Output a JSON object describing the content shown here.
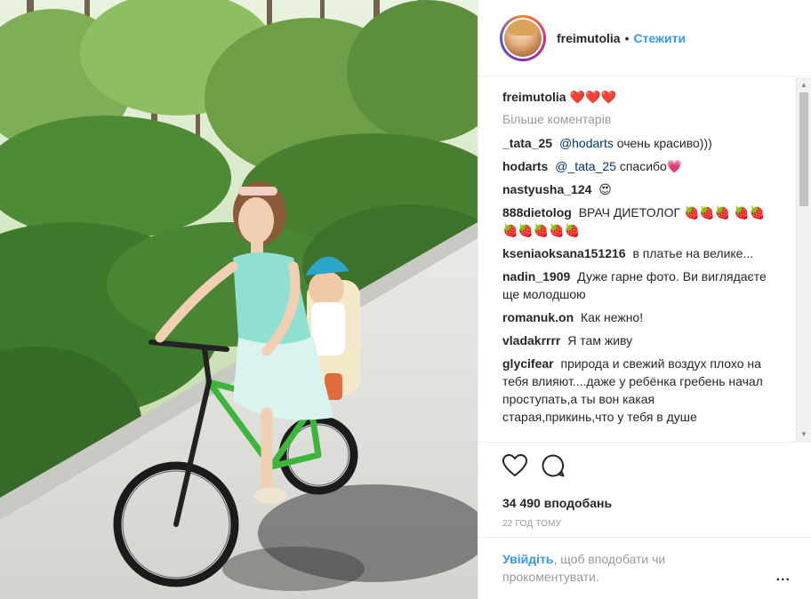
{
  "post": {
    "username": "freimutolia",
    "follow_label": "Стежити",
    "dot": "•"
  },
  "photo": {
    "alt_subject": "woman-on-bicycle-with-child"
  },
  "comments": {
    "caption": {
      "user": "freimutolia",
      "text": "❤️❤️❤️"
    },
    "load_more": "Більше коментарів",
    "items": [
      {
        "user": "_tata_25",
        "mention": "@hodarts",
        "text": "очень красиво)))"
      },
      {
        "user": "hodarts",
        "mention": "@_tata_25",
        "text": "спасибо💗"
      },
      {
        "user": "nastyusha_124",
        "mention": "",
        "text": "😍"
      },
      {
        "user": "888dietolog",
        "mention": "",
        "text": "ВРАЧ ДИЕТОЛОГ 🍓🍓🍓 🍓🍓🍓🍓🍓🍓🍓"
      },
      {
        "user": "kseniaoksana151216",
        "mention": "",
        "text": "в платье на велике..."
      },
      {
        "user": "nadin_1909",
        "mention": "",
        "text": "Дуже гарне фото. Ви виглядаєте ще молодшою"
      },
      {
        "user": "romanuk.on",
        "mention": "",
        "text": "Как нежно!"
      },
      {
        "user": "vladakrrrr",
        "mention": "",
        "text": "Я там живу"
      },
      {
        "user": "glycifear",
        "mention": "",
        "text": "природа и свежий воздух плохо на тебя влияют....даже у ребёнка гребень начал проступать,а ты вон какая старая,прикинь,что у тебя в душе"
      }
    ]
  },
  "stats": {
    "likes": "34 490 вподобань",
    "time": "22 год тому"
  },
  "login": {
    "link": "Увійдіть",
    "rest": ", щоб вподобати чи прокоментувати.",
    "more": "..."
  },
  "colors": {
    "link": "#3897f0",
    "mention": "#003569",
    "muted": "#999999"
  }
}
